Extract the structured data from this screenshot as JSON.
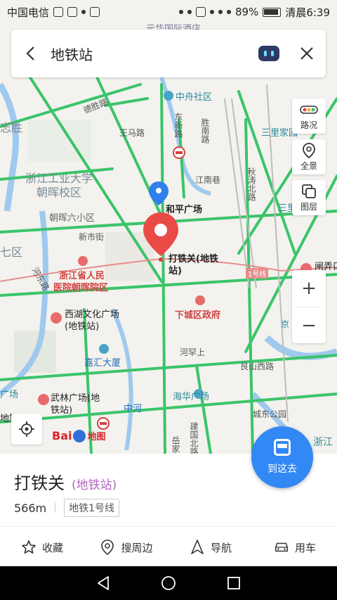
{
  "status_bar": {
    "carrier": "中国电信",
    "battery": "89%",
    "time_label": "清晨6:39"
  },
  "search": {
    "query": "地铁站"
  },
  "controls": {
    "traffic_label": "路况",
    "overview_label": "全景",
    "layers_label": "图层",
    "zoom_in": "+",
    "zoom_out": "−"
  },
  "map": {
    "labels": [
      "中舟社区",
      "德胜路",
      "东新路",
      "胜南路",
      "王马路",
      "三里家园",
      "浙江工业大学",
      "朝晖校区",
      "江南巷",
      "和平广场",
      "朝晖六小区",
      "新市街",
      "浙江省人民",
      "医院朝晖院区",
      "打铁关(地铁",
      "站)",
      "1号线",
      "西湖文化广场",
      "(地铁站)",
      "下城区政府",
      "嘉汇大厦",
      "河罕上",
      "艮山西路",
      "武林广场(地",
      "铁站)",
      "海华广场",
      "中河",
      "城东公园",
      "建国北路",
      "闸弄口",
      "志胜",
      "七区",
      "三里",
      "浙江",
      "广场",
      "地铁",
      "元华国际酒店",
      "岳家",
      "河东路",
      "京",
      "秋涛北路"
    ],
    "logo_text": "Bai",
    "logo_sub": "地图"
  },
  "go_button": {
    "label": "到这去"
  },
  "card": {
    "name": "打铁关",
    "type": "(地铁站)",
    "distance": "566m",
    "line": "地铁1号线",
    "actions": [
      "收藏",
      "搜周边",
      "导航",
      "用车"
    ]
  },
  "colors": {
    "primary": "#3288f4",
    "road": "#3bc46a",
    "pin_red": "#ea4a46",
    "pin_blue": "#2f80ed"
  }
}
